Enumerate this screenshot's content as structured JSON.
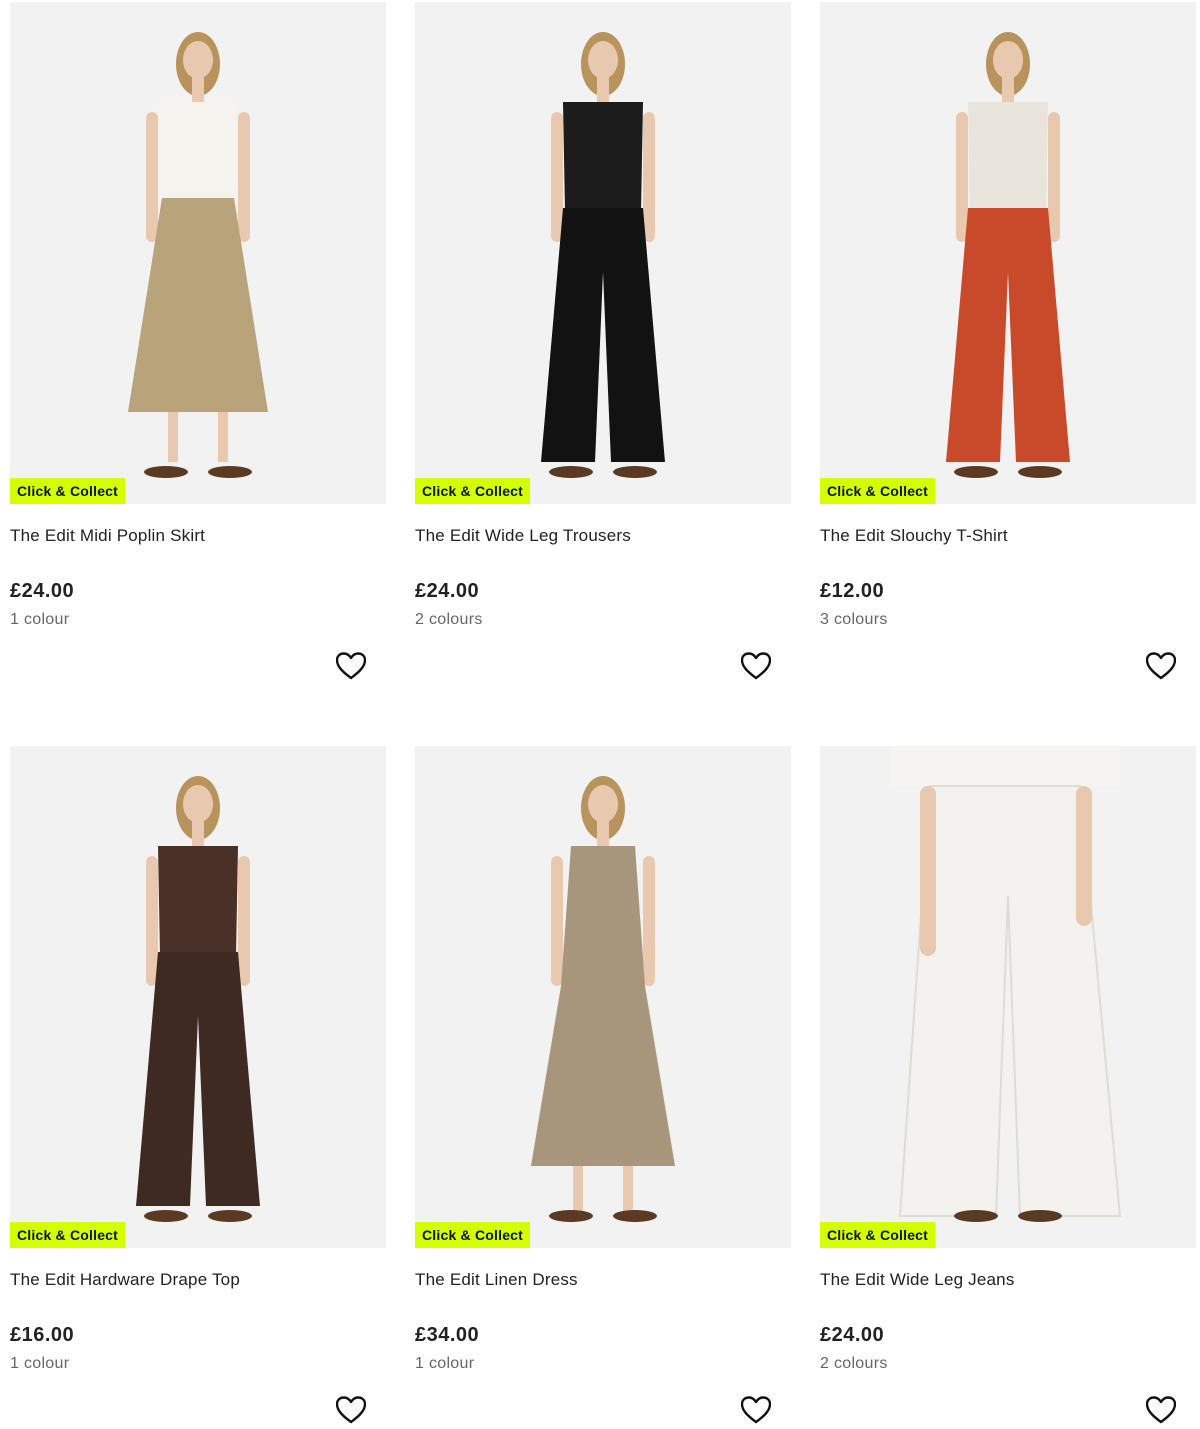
{
  "products": [
    {
      "title": "The Edit Midi Poplin Skirt",
      "price": "£24.00",
      "colours": "1 colour",
      "badge": "Click & Collect",
      "image_icon": "model-midi-skirt",
      "top_color": "#f4f3ee",
      "bottom_color": "#b9a37a",
      "bottom_kind": "skirt"
    },
    {
      "title": "The Edit Wide Leg Trousers",
      "price": "£24.00",
      "colours": "2 colours",
      "badge": "Click & Collect",
      "image_icon": "model-wide-leg-trousers",
      "top_color": "#1c1c1c",
      "bottom_color": "#121212",
      "bottom_kind": "trousers"
    },
    {
      "title": "The Edit Slouchy T-Shirt",
      "price": "£12.00",
      "colours": "3 colours",
      "badge": "Click & Collect",
      "image_icon": "model-slouchy-tshirt",
      "top_color": "#e9e5dc",
      "bottom_color": "#c84a2a",
      "bottom_kind": "trousers"
    },
    {
      "title": "The Edit Hardware Drape Top",
      "price": "£16.00",
      "colours": "1 colour",
      "badge": "Click & Collect",
      "image_icon": "model-drape-top",
      "top_color": "#4a3128",
      "bottom_color": "#3e2a22",
      "bottom_kind": "trousers"
    },
    {
      "title": "The Edit Linen Dress",
      "price": "£34.00",
      "colours": "1 colour",
      "badge": "Click & Collect",
      "image_icon": "model-linen-dress",
      "top_color": "#a8967c",
      "bottom_color": "#a8967c",
      "bottom_kind": "dress"
    },
    {
      "title": "The Edit Wide Leg Jeans",
      "price": "£24.00",
      "colours": "2 colours",
      "badge": "Click & Collect",
      "image_icon": "model-wide-leg-jeans",
      "top_color": "#f5f4f0",
      "bottom_color": "#f3f2ee",
      "bottom_kind": "jeans"
    }
  ],
  "accent": "#d4ff00",
  "wishlist_icon": "heart-icon"
}
